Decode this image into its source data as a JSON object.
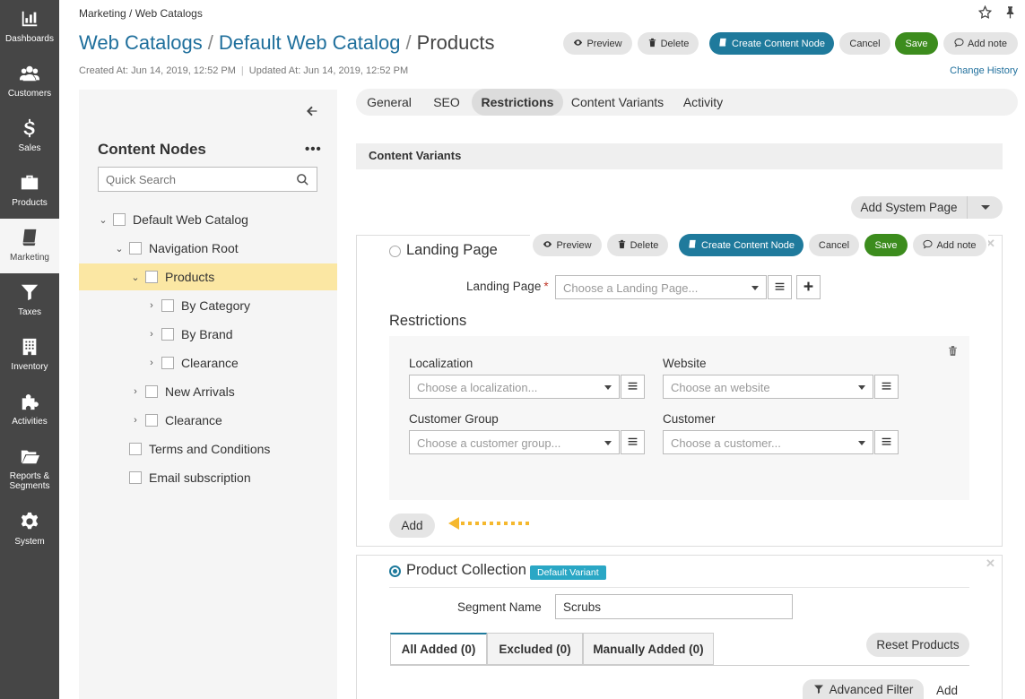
{
  "nav": [
    {
      "label": "Dashboards",
      "icon": "dashboards-icon"
    },
    {
      "label": "Customers",
      "icon": "customers-icon"
    },
    {
      "label": "Sales",
      "icon": "sales-icon"
    },
    {
      "label": "Products",
      "icon": "products-icon"
    },
    {
      "label": "Marketing",
      "icon": "marketing-icon",
      "active": true
    },
    {
      "label": "Taxes",
      "icon": "taxes-icon"
    },
    {
      "label": "Inventory",
      "icon": "inventory-icon"
    },
    {
      "label": "Activities",
      "icon": "activities-icon"
    },
    {
      "label": "Reports & Segments",
      "icon": "reports-icon"
    },
    {
      "label": "System",
      "icon": "system-icon"
    }
  ],
  "header": {
    "breadcrumb": "Marketing / Web Catalogs",
    "title_link1": "Web Catalogs",
    "title_sep": "/",
    "title_link2": "Default Web Catalog",
    "title_current": "Products",
    "created": "Created At: Jun 14, 2019, 12:52 PM",
    "updated": "Updated At: Jun 14, 2019, 12:52 PM",
    "change_history": "Change History"
  },
  "actions": {
    "preview": "Preview",
    "delete": "Delete",
    "create_node": "Create Content Node",
    "cancel": "Cancel",
    "save": "Save",
    "add_note": "Add note"
  },
  "tree": {
    "title": "Content Nodes",
    "more": "•••",
    "search_placeholder": "Quick Search",
    "items": [
      {
        "label": "Default Web Catalog",
        "toggle": "⌄"
      },
      {
        "label": "Navigation Root",
        "toggle": "⌄"
      },
      {
        "label": "Products",
        "toggle": "⌄"
      },
      {
        "label": "By Category",
        "toggle": "›"
      },
      {
        "label": "By Brand",
        "toggle": "›"
      },
      {
        "label": "Clearance",
        "toggle": "›"
      },
      {
        "label": "New Arrivals",
        "toggle": "›"
      },
      {
        "label": "Clearance",
        "toggle": "›"
      },
      {
        "label": "Terms and Conditions",
        "toggle": ""
      },
      {
        "label": "Email subscription",
        "toggle": ""
      }
    ]
  },
  "tabs": [
    "General",
    "SEO",
    "Restrictions",
    "Content Variants",
    "Activity"
  ],
  "active_tab": "Restrictions",
  "section": {
    "title": "Content Variants"
  },
  "add_system_page": "Add System Page",
  "landing": {
    "title": "Landing Page",
    "field_label": "Landing Page",
    "required_mark": "*",
    "placeholder": "Choose a Landing Page...",
    "restrictions_title": "Restrictions",
    "localization_label": "Localization",
    "localization_placeholder": "Choose a localization...",
    "website_label": "Website",
    "website_placeholder": "Choose an website",
    "customer_group_label": "Customer Group",
    "customer_group_placeholder": "Choose a customer group...",
    "customer_label": "Customer",
    "customer_placeholder": "Choose a customer...",
    "add_button": "Add"
  },
  "collection": {
    "title": "Product Collection",
    "badge": "Default Variant",
    "segment_label": "Segment Name",
    "segment_value": "Scrubs",
    "tabs": [
      "All Added (0)",
      "Excluded (0)",
      "Manually Added (0)"
    ],
    "reset": "Reset Products",
    "advanced_filter": "Advanced Filter",
    "add": "Add"
  },
  "colors": {
    "teal": "#1f7a9c",
    "green": "#3c8c1d",
    "selected_row": "#fbe7a3",
    "arrow": "#f5b82e"
  }
}
